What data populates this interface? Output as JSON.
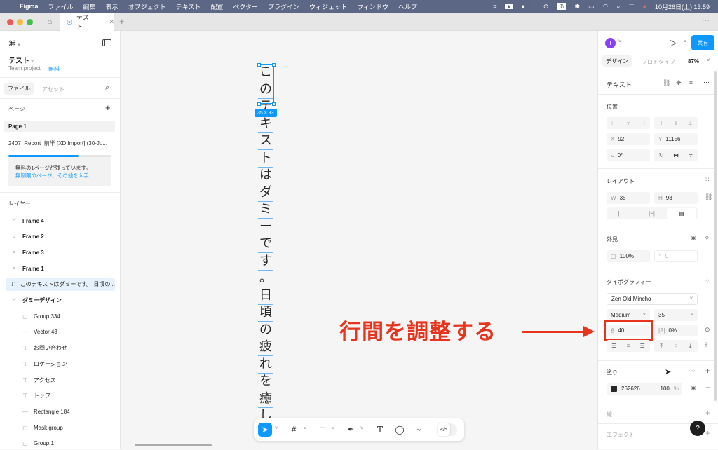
{
  "menubar": {
    "app": "Figma",
    "items": [
      "ファイル",
      "編集",
      "表示",
      "オブジェクト",
      "テキスト",
      "配置",
      "ベクター",
      "プラグイン",
      "ウィジェット",
      "ウィンドウ",
      "ヘルプ"
    ],
    "clock": "10月26日(土) 13:59",
    "ime": "あ"
  },
  "tabs": {
    "active_label": "テスト"
  },
  "left": {
    "file_name": "テスト",
    "project": "Team project",
    "plan_badge": "無料",
    "tab_files": "ファイル",
    "tab_assets": "アセット",
    "pages_title": "ページ",
    "pages": [
      "Page 1",
      "2407_Report_前半  [XD Import] (30-Ju..."
    ],
    "upgrade_progress": 0.68,
    "notice_line1": "無料の1ページが残っています。",
    "notice_link": "無制限のページ、その他を入手",
    "layers_title": "レイヤー",
    "layers": [
      {
        "icon": "frame",
        "label": "Frame 4",
        "bold": true
      },
      {
        "icon": "frame",
        "label": "Frame 2",
        "bold": true
      },
      {
        "icon": "frame",
        "label": "Frame 3",
        "bold": true
      },
      {
        "icon": "frame",
        "label": "Frame 1",
        "bold": true
      },
      {
        "icon": "text",
        "label": "このテキストはダミーです。 日頃の...",
        "bold": false,
        "selected": true
      },
      {
        "icon": "frame",
        "label": "ダミーデザイン",
        "bold": true
      },
      {
        "icon": "group",
        "label": "Group 334",
        "bold": false,
        "child": true
      },
      {
        "icon": "line",
        "label": "Vector 43",
        "bold": false,
        "child": true
      },
      {
        "icon": "text",
        "label": "お問い合わせ",
        "bold": false,
        "child": true
      },
      {
        "icon": "text",
        "label": "ロケーション",
        "bold": false,
        "child": true
      },
      {
        "icon": "text",
        "label": "アクセス",
        "bold": false,
        "child": true
      },
      {
        "icon": "text",
        "label": "トップ",
        "bold": false,
        "child": true
      },
      {
        "icon": "line",
        "label": "Rectangle 184",
        "bold": false,
        "child": true
      },
      {
        "icon": "group",
        "label": "Mask group",
        "bold": false,
        "child": true
      },
      {
        "icon": "group",
        "label": "Group 1",
        "bold": false,
        "child": true
      }
    ]
  },
  "canvas": {
    "vertical_text": [
      "こ",
      "の",
      "テ",
      "キ",
      "ス",
      "ト",
      "は",
      "ダ",
      "ミ",
      "ー",
      "で",
      "す",
      "。",
      "日",
      "頃",
      "の",
      "疲",
      "れ",
      "を",
      "癒",
      "し",
      "旅"
    ],
    "size_badge": "35 × 93",
    "annotation": "行間を調整する",
    "annotation_color": "#e8341c"
  },
  "right": {
    "avatar_initial": "T",
    "share_label": "共有",
    "tab_design": "デザイン",
    "tab_prototype": "プロトタイプ",
    "zoom": "87%",
    "layer_type": "テキスト",
    "position_title": "位置",
    "x_label": "X",
    "x_value": "92",
    "y_label": "Y",
    "y_value": "11156",
    "rotation": "0°",
    "layout_title": "レイアウト",
    "w_label": "W",
    "w_value": "35",
    "h_label": "H",
    "h_value": "93",
    "appearance_title": "外見",
    "opacity": "100%",
    "radius": "0",
    "typography_title": "タイポグラフィー",
    "font_family": "Zen Old Mincho",
    "font_weight": "Medium",
    "font_size": "35",
    "line_height": "40",
    "letter_spacing": "0%",
    "fill_title": "塗り",
    "fill_hex": "262626",
    "fill_opacity": "100",
    "fill_pct": "%",
    "fill_color": "#262626",
    "stroke_title": "線",
    "effects_title": "エフェクト",
    "help": "?",
    "accent": "#0d99ff"
  }
}
